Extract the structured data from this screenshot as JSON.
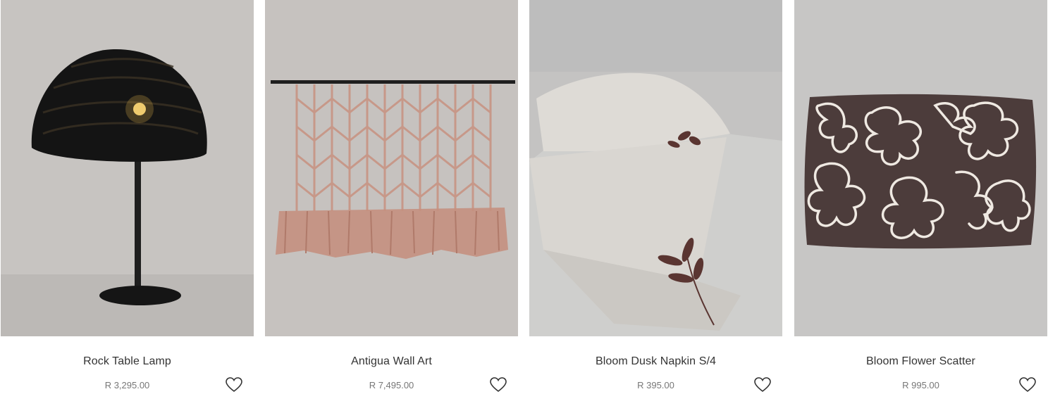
{
  "products": [
    {
      "name": "Rock Table Lamp",
      "price": "R 3,295.00",
      "image_icon": "table-lamp-photo",
      "wishlist_icon": "heart-outline-icon"
    },
    {
      "name": "Antigua Wall Art",
      "price": "R 7,495.00",
      "image_icon": "macrame-wall-art-photo",
      "wishlist_icon": "heart-outline-icon"
    },
    {
      "name": "Bloom Dusk Napkin S/4",
      "price": "R 395.00",
      "image_icon": "linen-napkin-photo",
      "wishlist_icon": "heart-outline-icon"
    },
    {
      "name": "Bloom Flower Scatter",
      "price": "R 995.00",
      "image_icon": "flower-cushion-photo",
      "wishlist_icon": "heart-outline-icon"
    }
  ],
  "colors": {
    "photo_background": "#c5c2bf",
    "text": "#333333",
    "price_text": "#777777"
  }
}
